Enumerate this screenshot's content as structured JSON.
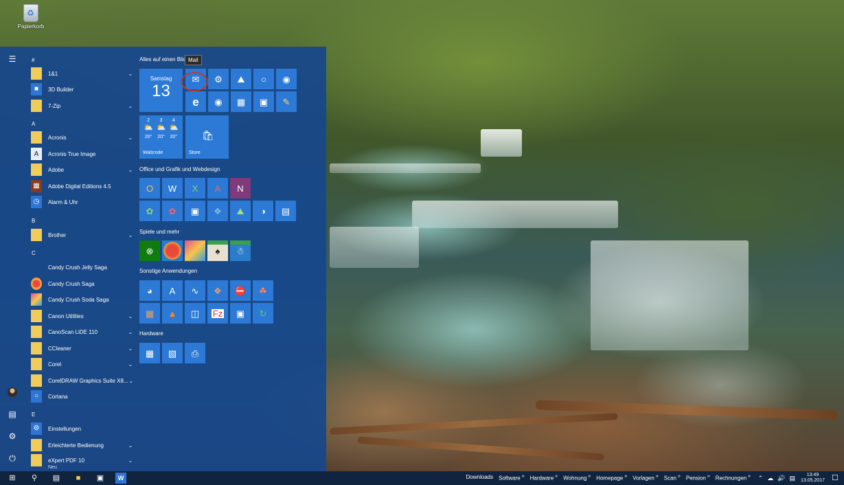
{
  "desktop": {
    "recycle_bin_label": "Papierkorb"
  },
  "start_menu": {
    "rail_icons": [
      "hamburger-icon",
      "user-avatar",
      "documents-icon",
      "settings-icon",
      "power-icon"
    ],
    "app_list": {
      "letters": {
        "hash": "#",
        "a": "A",
        "b": "B",
        "c": "C",
        "e": "E"
      },
      "apps": [
        {
          "label": "1&1",
          "icon": "folder-icon",
          "expandable": true
        },
        {
          "label": "3D Builder",
          "icon": "3d-builder-icon",
          "expandable": false
        },
        {
          "label": "7-Zip",
          "icon": "folder-icon",
          "expandable": true
        },
        {
          "label": "Acronis",
          "icon": "folder-icon",
          "expandable": true
        },
        {
          "label": "Acronis True Image",
          "icon": "acronis-icon",
          "expandable": false
        },
        {
          "label": "Adobe",
          "icon": "folder-icon",
          "expandable": true
        },
        {
          "label": "Adobe Digital Editions 4.5",
          "icon": "adobe-de-icon",
          "expandable": false
        },
        {
          "label": "Alarm & Uhr",
          "icon": "alarm-clock-icon",
          "expandable": false
        },
        {
          "label": "Brother",
          "icon": "folder-icon",
          "expandable": true
        },
        {
          "label": "Candy Crush Jelly Saga",
          "icon": "candy-jelly-icon",
          "expandable": false
        },
        {
          "label": "Candy Crush Saga",
          "icon": "candy-crush-icon",
          "expandable": false
        },
        {
          "label": "Candy Crush Soda Saga",
          "icon": "candy-soda-icon",
          "expandable": false
        },
        {
          "label": "Canon Utilities",
          "icon": "folder-icon",
          "expandable": true
        },
        {
          "label": "CanoScan LiDE 110",
          "icon": "folder-icon",
          "expandable": true
        },
        {
          "label": "CCleaner",
          "icon": "folder-icon",
          "expandable": true
        },
        {
          "label": "Corel",
          "icon": "folder-icon",
          "expandable": true
        },
        {
          "label": "CorelDRAW Graphics Suite X8...",
          "icon": "folder-icon",
          "expandable": true
        },
        {
          "label": "Cortana",
          "icon": "cortana-icon",
          "expandable": false
        },
        {
          "label": "Einstellungen",
          "icon": "settings-gear-icon",
          "expandable": false
        },
        {
          "label": "Erleichterte Bedienung",
          "icon": "folder-icon",
          "expandable": true
        },
        {
          "label": "eXpert PDF 10",
          "icon": "folder-icon",
          "expandable": true,
          "sub": "Neu"
        }
      ]
    },
    "tiles": {
      "group1": "Alles auf einen Blick",
      "tooltip": "Mail",
      "calendar": {
        "day": "Samstag",
        "date": "13"
      },
      "weather": {
        "days": [
          "2",
          "3",
          "4"
        ],
        "temps": [
          "20°",
          "20°",
          "20°"
        ],
        "city": "Walsrode"
      },
      "store_label": "Store",
      "group2": "Office und Grafik und Webdesign",
      "group3": "Spiele und mehr",
      "group4": "Sonstige Anwendungen",
      "group5": "Hardware"
    }
  },
  "taskbar": {
    "quick_links": [
      "Downloads",
      "Software",
      "Hardware",
      "Wohnung",
      "Homepage",
      "Vorlagen",
      "Scan",
      "Pension",
      "Rechnungen"
    ],
    "clock_time": "13:49",
    "clock_date": "13.05.2017"
  }
}
